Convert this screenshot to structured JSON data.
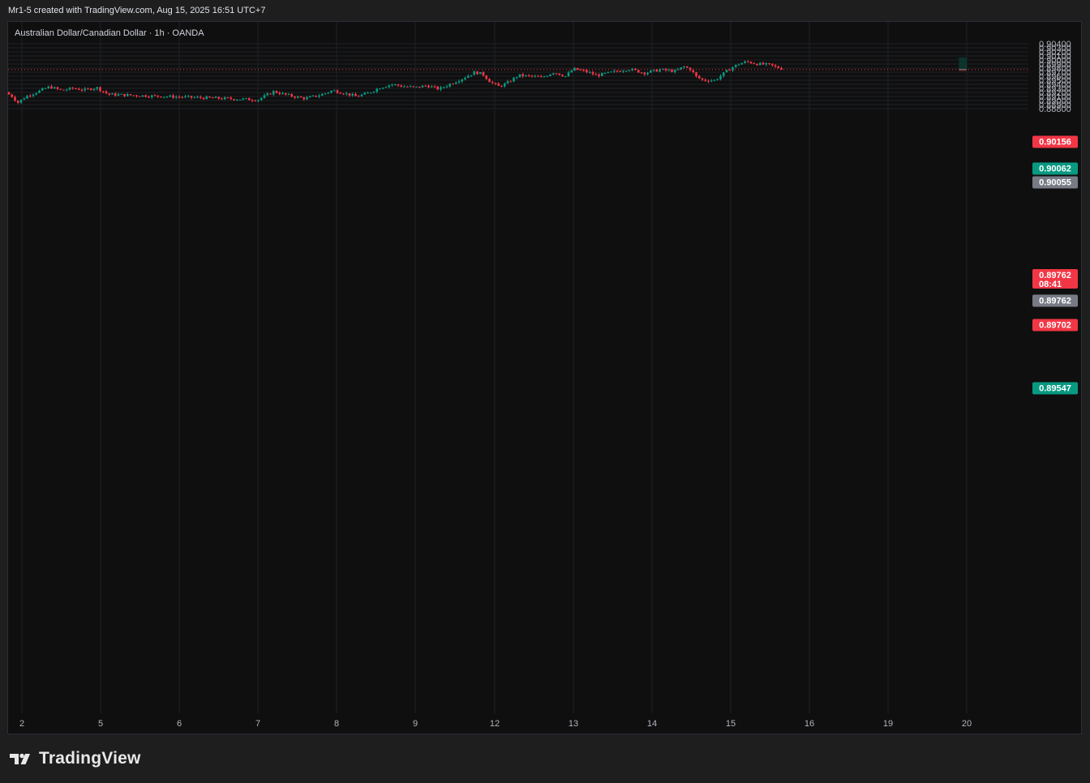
{
  "header": {
    "text": "Mr1-5 created with TradingView.com, Aug 15, 2025 16:51 UTC+7"
  },
  "symbol": {
    "text": "Australian Dollar/Canadian Dollar · 1h · OANDA"
  },
  "footer": {
    "brand": "TradingView",
    "icon": "tradingview-logo-icon"
  },
  "colors": {
    "up": "#089981",
    "down": "#f23645",
    "grid": "#1f2127",
    "price_line": "#f23645",
    "tag_red": "#f23645",
    "tag_green": "#089981",
    "tag_gray": "#787b86",
    "box_green": "#0c3a30",
    "box_red": "#3b1416"
  },
  "chart_data": {
    "type": "candlestick",
    "title": "",
    "ylim": [
      0.8875,
      0.9043
    ],
    "y_ticks": [
      "0.90400",
      "0.90300",
      "0.90200",
      "0.90100",
      "0.90000",
      "0.89900",
      "0.89800",
      "0.89700",
      "0.89600",
      "0.89500",
      "0.89400",
      "0.89300",
      "0.89200",
      "0.89100",
      "0.89000",
      "0.88900",
      "0.88800"
    ],
    "x_ticks": [
      "2",
      "5",
      "6",
      "7",
      "8",
      "9",
      "12",
      "13",
      "14",
      "15",
      "16",
      "19",
      "20"
    ],
    "current_price": 0.89762,
    "price_tags": [
      {
        "label": "0.90156",
        "value": 0.90156,
        "color": "tag_red"
      },
      {
        "label": "0.90062",
        "value": 0.90062,
        "color": "tag_green"
      },
      {
        "label": "0.90055",
        "value": 0.90055,
        "color": "tag_gray"
      },
      {
        "label": "0.89762",
        "value": 0.89762,
        "color": "tag_red",
        "sub": "08:41"
      },
      {
        "label": "0.89762",
        "value": 0.89762,
        "color": "tag_gray"
      },
      {
        "label": "0.89702",
        "value": 0.89702,
        "color": "tag_red"
      },
      {
        "label": "0.89547",
        "value": 0.89547,
        "color": "tag_green"
      }
    ],
    "positions": [
      {
        "type": "short",
        "x_start": 13.9,
        "x_end": 14.95,
        "entry": 0.89762,
        "stop": 0.89702,
        "target": 0.90062
      },
      {
        "type": "long",
        "x_start": 15.7,
        "x_end": 16.08,
        "entry": 0.90055,
        "stop": 0.90156,
        "target": 0.89547
      }
    ],
    "anchors": [
      [
        1.85,
        0.8915
      ],
      [
        1.95,
        0.8895
      ],
      [
        2.05,
        0.891
      ],
      [
        2.2,
        0.8922
      ],
      [
        2.35,
        0.8934
      ],
      [
        2.5,
        0.8925
      ],
      [
        2.65,
        0.893
      ],
      [
        2.8,
        0.8926
      ],
      [
        2.95,
        0.8932
      ],
      [
        3.1,
        0.8915
      ],
      [
        5.0,
        0.8902
      ],
      [
        5.2,
        0.8922
      ],
      [
        5.4,
        0.8912
      ],
      [
        5.6,
        0.8905
      ],
      [
        5.8,
        0.8914
      ],
      [
        5.95,
        0.8925
      ],
      [
        6.1,
        0.8918
      ],
      [
        6.25,
        0.891
      ],
      [
        6.4,
        0.8918
      ],
      [
        6.55,
        0.8932
      ],
      [
        6.7,
        0.894
      ],
      [
        6.85,
        0.8935
      ],
      [
        7.0,
        0.8932
      ],
      [
        7.15,
        0.8937
      ],
      [
        7.3,
        0.8928
      ],
      [
        7.45,
        0.8942
      ],
      [
        7.6,
        0.8955
      ],
      [
        7.75,
        0.897
      ],
      [
        7.85,
        0.8965
      ],
      [
        7.95,
        0.8945
      ],
      [
        8.05,
        0.8935
      ],
      [
        8.15,
        0.8942
      ],
      [
        8.3,
        0.8962
      ],
      [
        8.45,
        0.896
      ],
      [
        8.6,
        0.8957
      ],
      [
        8.75,
        0.897
      ],
      [
        8.9,
        0.896
      ],
      [
        9.0,
        0.8978
      ],
      [
        9.15,
        0.8972
      ],
      [
        9.3,
        0.8962
      ],
      [
        9.5,
        0.897
      ],
      [
        9.7,
        0.8978
      ],
      [
        9.9,
        0.8968
      ],
      [
        10.1,
        0.8976
      ],
      [
        10.3,
        0.8972
      ],
      [
        10.4,
        0.8984
      ],
      [
        10.5,
        0.8976
      ],
      [
        10.55,
        0.896
      ],
      [
        10.65,
        0.895
      ],
      [
        10.8,
        0.895
      ],
      [
        10.9,
        0.8965
      ],
      [
        11.0,
        0.898
      ],
      [
        11.1,
        0.899
      ],
      [
        11.2,
        0.8996
      ],
      [
        11.35,
        0.899
      ],
      [
        11.5,
        0.8988
      ],
      [
        11.6,
        0.898
      ],
      [
        11.7,
        0.8995
      ],
      [
        11.8,
        0.9005
      ],
      [
        11.9,
        0.902
      ],
      [
        12.0,
        0.9025
      ],
      [
        12.1,
        0.9015
      ],
      [
        12.2,
        0.9008
      ],
      [
        12.3,
        0.9006
      ],
      [
        12.4,
        0.9012
      ],
      [
        12.5,
        0.9025
      ],
      [
        12.6,
        0.9012
      ],
      [
        12.7,
        0.9
      ],
      [
        12.8,
        0.899
      ],
      [
        12.9,
        0.898
      ],
      [
        12.95,
        0.8972
      ],
      [
        13.05,
        0.8962
      ],
      [
        13.15,
        0.896
      ],
      [
        13.25,
        0.8966
      ],
      [
        13.35,
        0.8976
      ],
      [
        13.45,
        0.8972
      ],
      [
        13.55,
        0.8972
      ],
      [
        13.65,
        0.897
      ],
      [
        13.75,
        0.8978
      ],
      [
        13.85,
        0.8975
      ]
    ]
  }
}
